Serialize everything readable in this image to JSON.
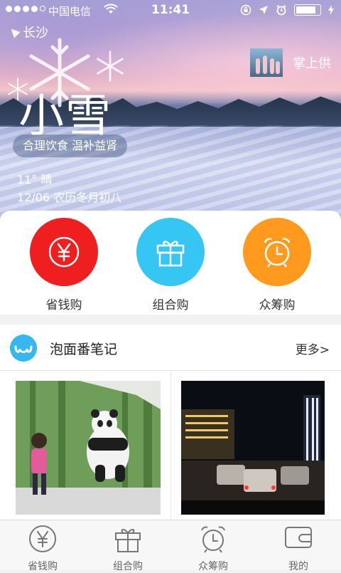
{
  "status_bar": {
    "carrier": "中国电信",
    "time": "11:41",
    "signal_bars_filled": 4,
    "signal_bars_total": 5,
    "battery_level": 0.9
  },
  "hero": {
    "location": "长沙",
    "weather_title": "小雪",
    "vendor_label": "掌上供",
    "tip": "合理饮食 温补益肾",
    "temp_line": "11° 晴",
    "date_line": "12/06 农历冬月初八"
  },
  "quick_entries": [
    {
      "label": "省钱购",
      "icon": "yen-coin-icon",
      "color": "#ef1f1f"
    },
    {
      "label": "组合购",
      "icon": "gift-box-icon",
      "color": "#35c6f4"
    },
    {
      "label": "众筹购",
      "icon": "alarm-clock-icon",
      "color": "#ff9a1e"
    }
  ],
  "section": {
    "title": "泡面番笔记",
    "more": "更多>"
  },
  "tabbar": [
    {
      "label": "省钱购",
      "icon": "yen-coin-icon"
    },
    {
      "label": "组合购",
      "icon": "gift-box-icon"
    },
    {
      "label": "众筹购",
      "icon": "alarm-clock-icon"
    },
    {
      "label": "我的",
      "icon": "wallet-icon"
    }
  ]
}
